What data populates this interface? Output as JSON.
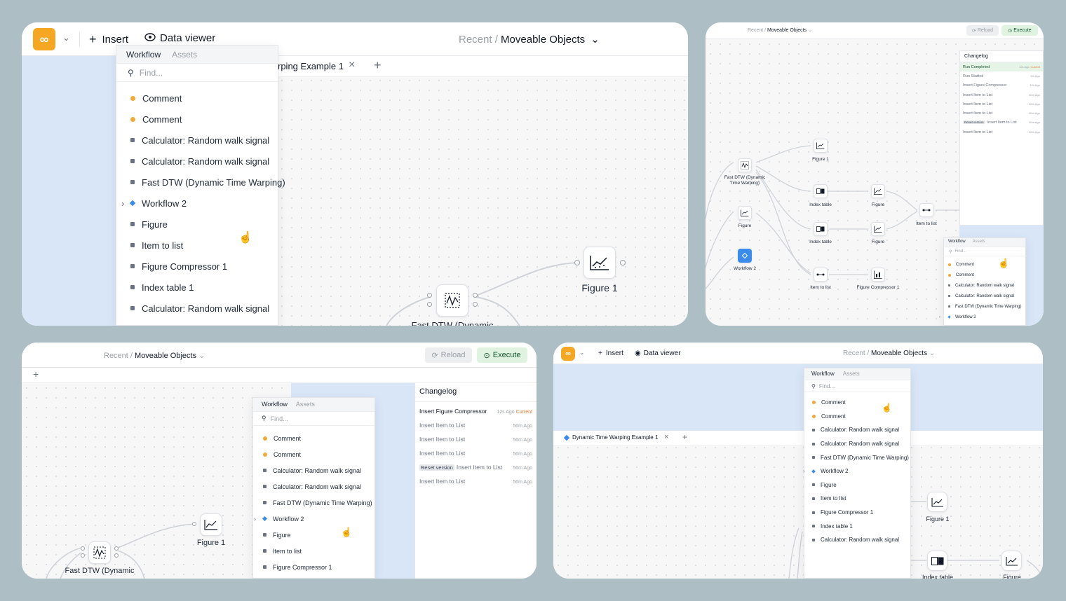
{
  "app": {
    "breadcrumb_recent": "Recent /",
    "breadcrumb_project": "Moveable Objects",
    "insert_label": "Insert",
    "data_viewer_label": "Data viewer",
    "reload_label": "Reload",
    "execute_label": "Execute",
    "tab_label": "Dynamic Time Warping Example 1",
    "tab_label_cut": "rping Example 1"
  },
  "menu": {
    "tab_workflow": "Workflow",
    "tab_assets": "Assets",
    "find_placeholder": "Find...",
    "items": [
      {
        "label": "Comment",
        "kind": "comment"
      },
      {
        "label": "Comment",
        "kind": "comment"
      },
      {
        "label": "Calculator: Random walk signal",
        "kind": "node"
      },
      {
        "label": "Calculator: Random walk signal",
        "kind": "node"
      },
      {
        "label": "Fast DTW (Dynamic Time Warping)",
        "kind": "node"
      },
      {
        "label": "Workflow 2",
        "kind": "workflow"
      },
      {
        "label": "Figure",
        "kind": "node"
      },
      {
        "label": "Item to list",
        "kind": "node"
      },
      {
        "label": "Figure Compressor 1",
        "kind": "node"
      },
      {
        "label": "Index table 1",
        "kind": "node"
      },
      {
        "label": "Calculator: Random walk signal",
        "kind": "node"
      }
    ]
  },
  "changelog": {
    "title": "Changelog",
    "reset_label": "Reset version",
    "current_label": "Current",
    "panel2_entries": [
      {
        "label": "Run Completed",
        "time": "12s Ago",
        "current": true
      },
      {
        "label": "Run Started",
        "time": "5m Ago"
      },
      {
        "label": "Insert Figure Compressor",
        "time": "12s Ago"
      },
      {
        "label": "Insert Item to List",
        "time": "50m Ago"
      },
      {
        "label": "Insert Item to List",
        "time": "50m Ago"
      },
      {
        "label": "Insert Item to List",
        "time": "50m Ago"
      },
      {
        "label": "Insert Item to List",
        "time": "50m Ago",
        "reset": true
      },
      {
        "label": "Insert Item to List",
        "time": "50m Ago"
      }
    ],
    "panel3_entries": [
      {
        "label": "Insert Figure Compressor",
        "time": "12s Ago",
        "current": true
      },
      {
        "label": "Insert Item to List",
        "time": "50m Ago"
      },
      {
        "label": "Insert Item to List",
        "time": "50m Ago"
      },
      {
        "label": "Insert Item to List",
        "time": "50m Ago"
      },
      {
        "label": "Insert Item to List",
        "time": "50m Ago",
        "reset": true
      },
      {
        "label": "Insert Item to List",
        "time": "50m Ago"
      }
    ]
  },
  "nodes": {
    "figure1": "Figure 1",
    "fast_dtw": "Fast DTW (Dynamic",
    "fast_dtw_2line": "Fast DTW (Dynamic Time Warping)",
    "figure": "Figure",
    "index_table": "Index table",
    "item_to_list": "Item to list",
    "workflow2": "Workflow 2",
    "figure_compressor1": "Figure Compressor 1"
  },
  "colors": {
    "accent": "#f5a623",
    "workflow_blue": "#3b8beb",
    "execute_green": "#dff3e0",
    "current_orange": "#e8772e"
  }
}
